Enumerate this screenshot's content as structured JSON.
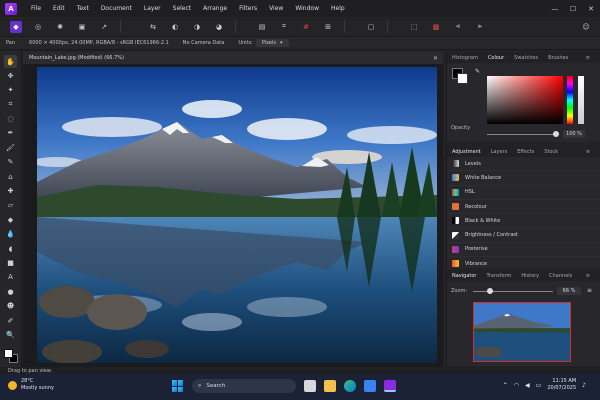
{
  "menubar": {
    "items": [
      "File",
      "Edit",
      "Text",
      "Document",
      "Layer",
      "Select",
      "Arrange",
      "Filters",
      "View",
      "Window",
      "Help"
    ]
  },
  "contextbar": {
    "tool_name": "Pan",
    "image_info": "6000 × 4000px, 24.00MP, RGBA/8 - sRGB IEC61966-2.1",
    "camera": "No Camera Data",
    "units_label": "Units:",
    "units_value": "Pixels"
  },
  "document": {
    "tab_title": "Mountain_Lake.jpg (Modified) (66.7%)"
  },
  "colour_panel": {
    "tabs": [
      "Histogram",
      "Colour",
      "Swatches",
      "Brushes"
    ],
    "active_tab": "Colour",
    "opacity_label": "Opacity",
    "opacity_value": "100 %",
    "selected_color": "#ffffff",
    "hue_color": "#ff0000"
  },
  "adjustment_panel": {
    "tabs": [
      "Adjustment",
      "Layers",
      "Effects",
      "Stock"
    ],
    "active_tab": "Adjustment",
    "items": [
      "Levels",
      "White Balance",
      "HSL",
      "Recolour",
      "Black & White",
      "Brightness / Contrast",
      "Posterise",
      "Vibrance"
    ]
  },
  "navigator_panel": {
    "tabs": [
      "Navigator",
      "Transform",
      "History",
      "Channels"
    ],
    "active_tab": "Navigator",
    "zoom_label": "Zoom:",
    "zoom_value": "66 %"
  },
  "statusbar": {
    "hint": "Drag to pan view."
  },
  "taskbar": {
    "temperature": "28°C",
    "weather": "Mostly sunny",
    "search_placeholder": "Search",
    "time": "11:15 AM",
    "date": "20/07/2025"
  }
}
